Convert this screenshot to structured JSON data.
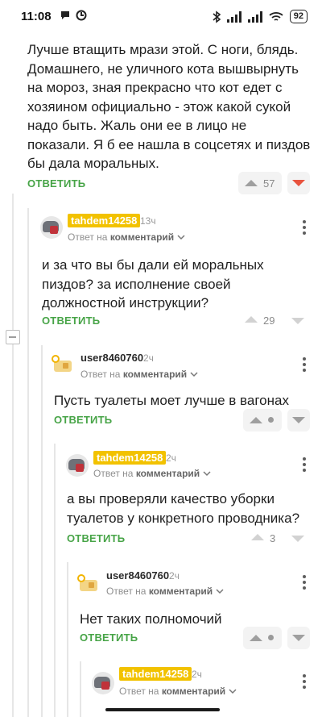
{
  "status_bar": {
    "time": "11:08",
    "battery": "92"
  },
  "comments": [
    {
      "id": "c0",
      "text": "Лучше втащить мрази этой. С ноги, блядь. Домашнего, не уличного кота вышвырнуть на мороз, зная прекрасно что кот едет с хозяином официально - этож какой сукой надо быть. Жаль они ее в лицо не показали. Я б ее нашла в соцсетях и пиздов бы дала моральных.",
      "reply_label": "ОТВЕТИТЬ",
      "rating": "57"
    },
    {
      "id": "c1",
      "username": "tahdem14258",
      "time": "13ч",
      "reply_to_prefix": "Ответ на",
      "reply_to_target": "комментарий",
      "text": "и за что вы бы дали ей моральных пиздов? за исполнение своей должностной инструкции?",
      "reply_label": "ОТВЕТИТЬ",
      "rating": "29"
    },
    {
      "id": "c2",
      "username": "user8460760",
      "time": "2ч",
      "reply_to_prefix": "Ответ на",
      "reply_to_target": "комментарий",
      "text": "Пусть туалеты моет лучше в вагонах",
      "reply_label": "ОТВЕТИТЬ"
    },
    {
      "id": "c3",
      "username": "tahdem14258",
      "time": "2ч",
      "reply_to_prefix": "Ответ на",
      "reply_to_target": "комментарий",
      "text": "а вы проверяли качество уборки туалетов у конкретного проводника?",
      "reply_label": "ОТВЕТИТЬ",
      "rating": "3"
    },
    {
      "id": "c4",
      "username": "user8460760",
      "time": "2ч",
      "reply_to_prefix": "Ответ на",
      "reply_to_target": "комментарий",
      "text": "Нет таких полномочий",
      "reply_label": "ОТВЕТИТЬ"
    },
    {
      "id": "c5",
      "username": "tahdem14258",
      "time": "2ч",
      "reply_to_prefix": "Ответ на",
      "reply_to_target": "комментарий"
    }
  ],
  "colors": {
    "accent_green": "#47a447",
    "badge_yellow": "#f2c200",
    "downvote_red": "#e8533e"
  }
}
